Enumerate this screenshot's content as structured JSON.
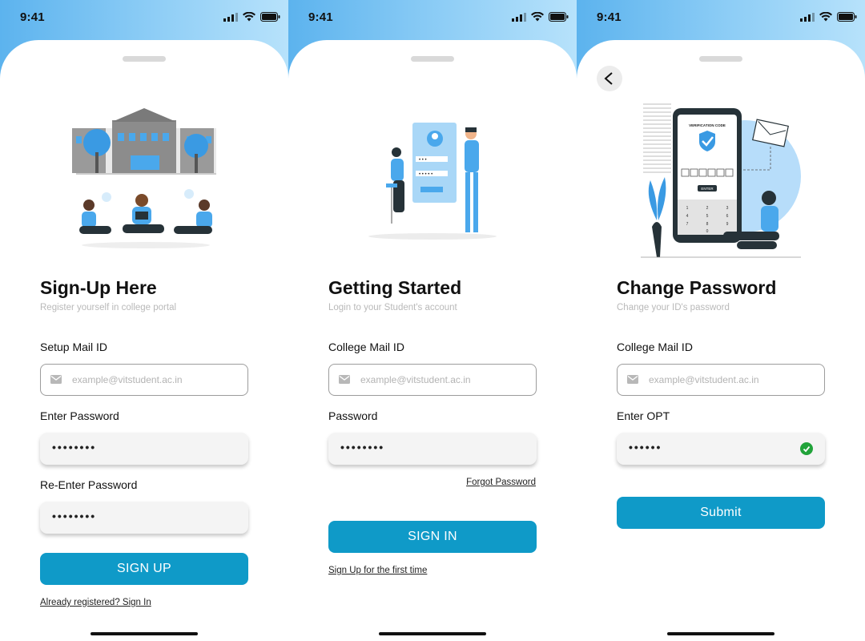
{
  "status_bar": {
    "time": "9:41"
  },
  "screens": [
    {
      "title": "Sign-Up Here",
      "subtitle": "Register yourself in college portal",
      "fields": [
        {
          "label": "Setup Mail ID",
          "placeholder": "example@vitstudent.ac.in"
        },
        {
          "label": "Enter Password",
          "value": "••••••••"
        },
        {
          "label": "Re-Enter Password",
          "value": "••••••••"
        }
      ],
      "button": "SIGN UP",
      "footer_link": "Already registered? Sign In"
    },
    {
      "title": "Getting Started",
      "subtitle": "Login to your Student's account",
      "fields": [
        {
          "label": "College Mail ID",
          "placeholder": "example@vitstudent.ac.in"
        },
        {
          "label": "Password",
          "value": "••••••••"
        }
      ],
      "forgot_link": "Forgot Password",
      "button": "SIGN IN",
      "footer_link": "Sign Up for the first time"
    },
    {
      "title": "Change Password",
      "subtitle": "Change your ID's password",
      "fields": [
        {
          "label": "College Mail ID",
          "placeholder": "example@vitstudent.ac.in"
        },
        {
          "label": "Enter OPT",
          "value": "••••••"
        }
      ],
      "button": "Submit",
      "illustration": {
        "heading": "VERIFICATION CODE",
        "enter": "ENTER",
        "keypad": [
          "1",
          "2",
          "3",
          "4",
          "5",
          "6",
          "7",
          "8",
          "9",
          "0"
        ]
      }
    }
  ],
  "colors": {
    "accent": "#0f9ac8",
    "header_blue": "#5cb3ee",
    "illustration_blue": "#4aa8ec",
    "success": "#21a33a"
  }
}
